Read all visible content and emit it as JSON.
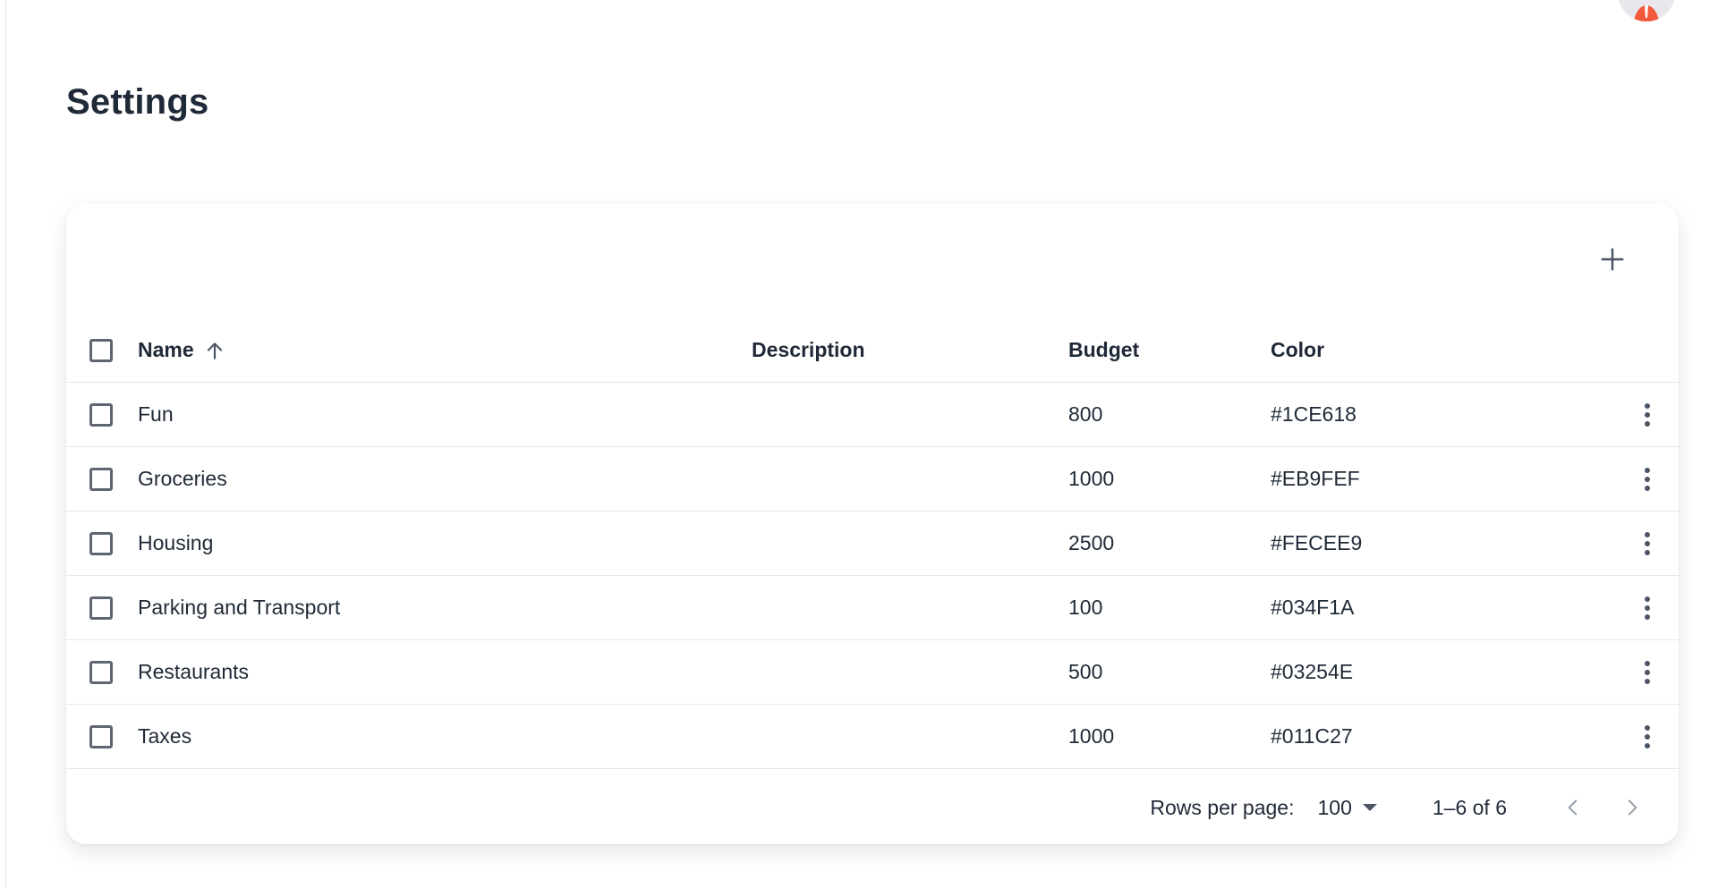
{
  "page": {
    "title": "Settings"
  },
  "avatar": {
    "icon": "user-avatar-icon"
  },
  "toolbar": {
    "add_icon": "plus-icon"
  },
  "table": {
    "columns": {
      "name": "Name",
      "description": "Description",
      "budget": "Budget",
      "color": "Color"
    },
    "sort": {
      "column": "Name",
      "direction": "ascending",
      "icon": "arrow-up-icon"
    },
    "rows": [
      {
        "name": "Fun",
        "description": "",
        "budget": "800",
        "color": "#1CE618"
      },
      {
        "name": "Groceries",
        "description": "",
        "budget": "1000",
        "color": "#EB9FEF"
      },
      {
        "name": "Housing",
        "description": "",
        "budget": "2500",
        "color": "#FECEE9"
      },
      {
        "name": "Parking and Transport",
        "description": "",
        "budget": "100",
        "color": "#034F1A"
      },
      {
        "name": "Restaurants",
        "description": "",
        "budget": "500",
        "color": "#03254E"
      },
      {
        "name": "Taxes",
        "description": "",
        "budget": "1000",
        "color": "#011C27"
      }
    ],
    "row_action_icon": "more-vertical-icon"
  },
  "pagination": {
    "rows_per_page_label": "Rows per page:",
    "rows_per_page_value": "100",
    "range_text": "1–6 of 6",
    "prev_icon": "chevron-left-icon",
    "next_icon": "chevron-right-icon"
  },
  "colors": {
    "text_primary": "#1f2937",
    "border": "#e5e7eb",
    "icon": "#4b5563",
    "avatar_accent": "#f25a3c"
  }
}
